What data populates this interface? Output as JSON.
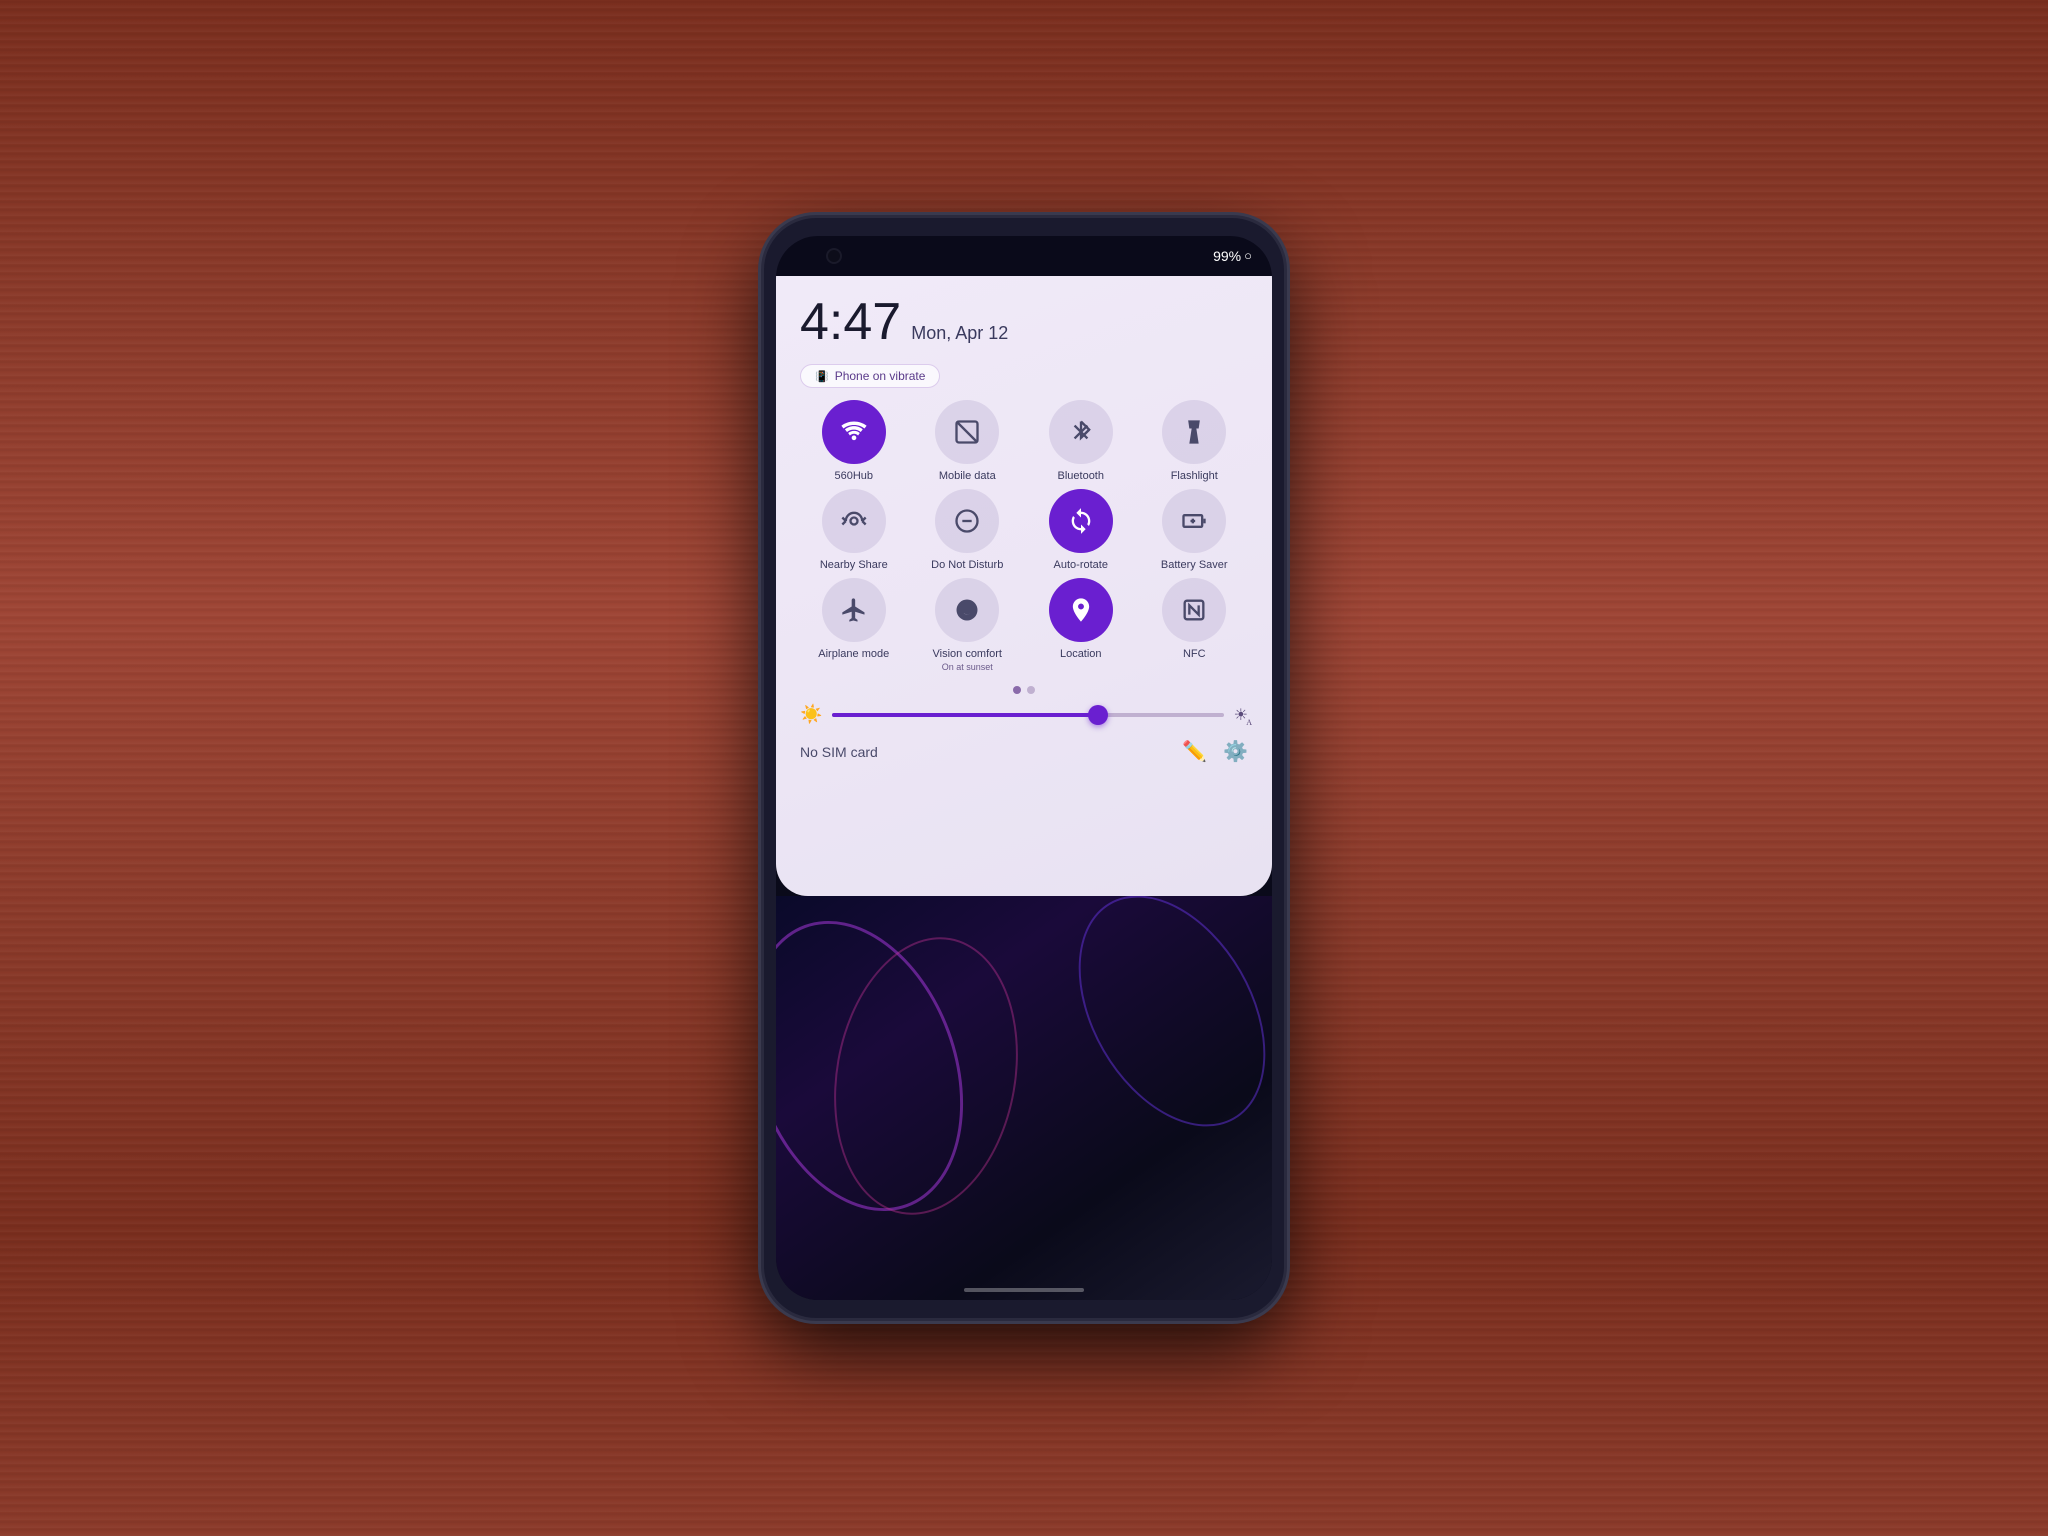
{
  "background": {
    "color": "#8B3A2A"
  },
  "statusBar": {
    "battery": "99%",
    "batteryIcon": "○"
  },
  "notificationPanel": {
    "time": "4:47",
    "date": "Mon, Apr 12",
    "vibratePill": {
      "label": "Phone on vibrate",
      "icon": "📳"
    },
    "tiles": [
      {
        "id": "560hub",
        "label": "560Hub",
        "icon": "wifi",
        "active": true
      },
      {
        "id": "mobile-data",
        "label": "Mobile data",
        "icon": "mobile",
        "active": false
      },
      {
        "id": "bluetooth",
        "label": "Bluetooth",
        "icon": "bluetooth",
        "active": false
      },
      {
        "id": "flashlight",
        "label": "Flashlight",
        "icon": "flashlight",
        "active": false
      },
      {
        "id": "nearby-share",
        "label": "Nearby Share",
        "icon": "nearby",
        "active": false
      },
      {
        "id": "do-not-disturb",
        "label": "Do Not Disturb",
        "icon": "dnd",
        "active": false
      },
      {
        "id": "auto-rotate",
        "label": "Auto-rotate",
        "icon": "rotate",
        "active": true
      },
      {
        "id": "battery-saver",
        "label": "Battery Saver",
        "icon": "battery",
        "active": false
      },
      {
        "id": "airplane-mode",
        "label": "Airplane mode",
        "icon": "airplane",
        "active": false
      },
      {
        "id": "vision-comfort",
        "label": "Vision comfort",
        "sublabel": "On at sunset",
        "icon": "moon",
        "active": false
      },
      {
        "id": "location",
        "label": "Location",
        "icon": "location",
        "active": true
      },
      {
        "id": "nfc",
        "label": "NFC",
        "icon": "nfc",
        "active": false
      }
    ],
    "brightness": {
      "fillPercent": 68,
      "minIcon": "☀",
      "maxIcon": "☀"
    },
    "simCard": "No SIM card",
    "editIcon": "✏",
    "settingsIcon": "⚙"
  }
}
